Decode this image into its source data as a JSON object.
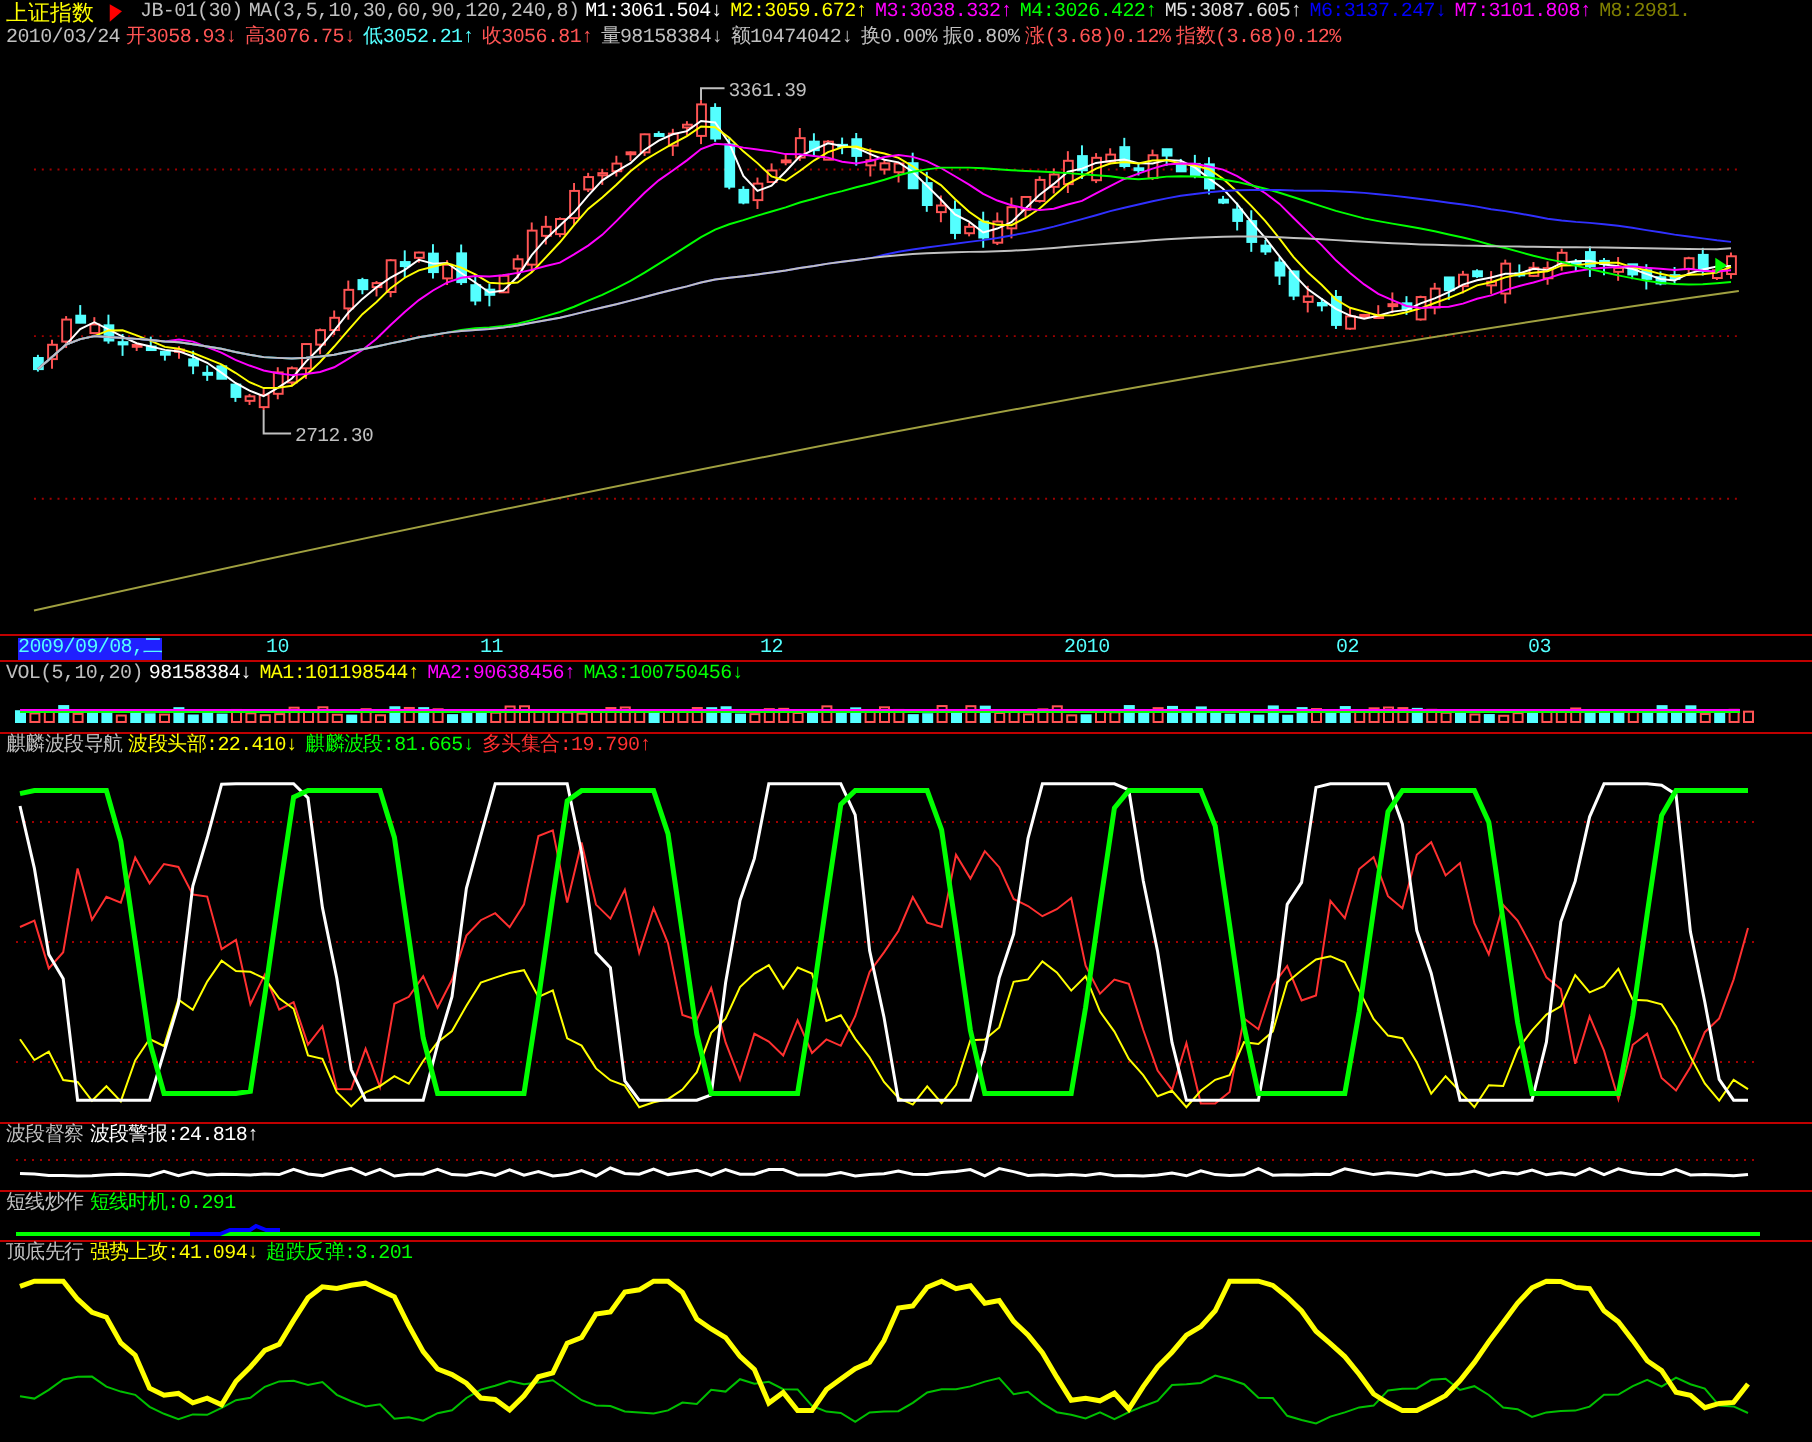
{
  "header": {
    "title": "上证指数",
    "items": [
      {
        "text": "JB-01(30)",
        "color": "#c0c0c0"
      },
      {
        "text": "MA(3,5,10,30,60,90,120,240,8)",
        "color": "#c0c0c0"
      },
      {
        "text": "M1:3061.504",
        "color": "#ffffff",
        "arrow": "↓"
      },
      {
        "text": "M2:3059.672",
        "color": "#ffff00",
        "arrow": "↑"
      },
      {
        "text": "M3:3038.332",
        "color": "#ff00ff",
        "arrow": "↑"
      },
      {
        "text": "M4:3026.422",
        "color": "#00ff00",
        "arrow": "↑"
      },
      {
        "text": "M5:3087.605",
        "color": "#e0e0e0",
        "arrow": "↑"
      },
      {
        "text": "M6:3137.247",
        "color": "#0000ff",
        "arrow": "↓"
      },
      {
        "text": "M7:3101.808",
        "color": "#ff00ff",
        "arrow": "↑"
      },
      {
        "text": "M8:2981.",
        "color": "#808000"
      }
    ]
  },
  "quote": {
    "date": "2010/03/24",
    "items": [
      {
        "text": "开3058.93",
        "color": "#ff5454",
        "arrow": "↓"
      },
      {
        "text": "高3076.75",
        "color": "#ff5454",
        "arrow": "↓"
      },
      {
        "text": "低3052.21",
        "color": "#54ffff",
        "arrow": "↑"
      },
      {
        "text": "收3056.81",
        "color": "#ff5454",
        "arrow": "↑"
      },
      {
        "text": "量98158384",
        "color": "#c0c0c0",
        "arrow": "↓"
      },
      {
        "text": "额10474042",
        "color": "#c0c0c0",
        "arrow": "↓"
      },
      {
        "text": "换0.00%",
        "color": "#c0c0c0"
      },
      {
        "text": "振0.80%",
        "color": "#c0c0c0"
      },
      {
        "text": "涨(3.68)0.12%",
        "color": "#ff5454"
      },
      {
        "text": "指数(3.68)0.12%",
        "color": "#ff5454"
      }
    ]
  },
  "price_chart": {
    "annotations": [
      {
        "kind": "high",
        "text": "3361.39"
      },
      {
        "kind": "low",
        "text": "2712.30"
      }
    ]
  },
  "time_axis": {
    "cursor_date": "2009/09/08,二",
    "labels": [
      "10",
      "11",
      "12",
      "2010",
      "02",
      "03"
    ]
  },
  "volume": {
    "title": "VOL(5,10,20)",
    "legend": [
      {
        "text": "98158384",
        "color": "#ffffff",
        "arrow": "↓"
      },
      {
        "text": "MA1:101198544",
        "color": "#ffff00",
        "arrow": "↑"
      },
      {
        "text": "MA2:90638456",
        "color": "#ff00ff",
        "arrow": "↑"
      },
      {
        "text": "MA3:100750456",
        "color": "#00ff00",
        "arrow": "↓"
      }
    ]
  },
  "indicators": [
    {
      "kind": "wave",
      "title": "麒麟波段导航",
      "legend": [
        {
          "text": "波段头部:22.410",
          "color": "#ffff00",
          "arrow": "↓"
        },
        {
          "text": "麒麟波段:81.665",
          "color": "#00ff00",
          "arrow": "↓"
        },
        {
          "text": "多头集合:19.790",
          "color": "#ff3030",
          "arrow": "↑"
        }
      ]
    },
    {
      "kind": "alarm",
      "title": "波段督察",
      "legend": [
        {
          "text": "波段警报:24.818",
          "color": "#ffffff",
          "arrow": "↑"
        }
      ]
    },
    {
      "kind": "short",
      "title": "短线炒作",
      "legend": [
        {
          "text": "短线时机:0.291",
          "color": "#00ff00"
        }
      ]
    },
    {
      "kind": "bottom",
      "title": "顶底先行",
      "legend": [
        {
          "text": "强势上攻:41.094",
          "color": "#ffff00",
          "arrow": "↓"
        },
        {
          "text": "超跌反弹:3.201",
          "color": "#00ff00"
        }
      ]
    }
  ]
}
